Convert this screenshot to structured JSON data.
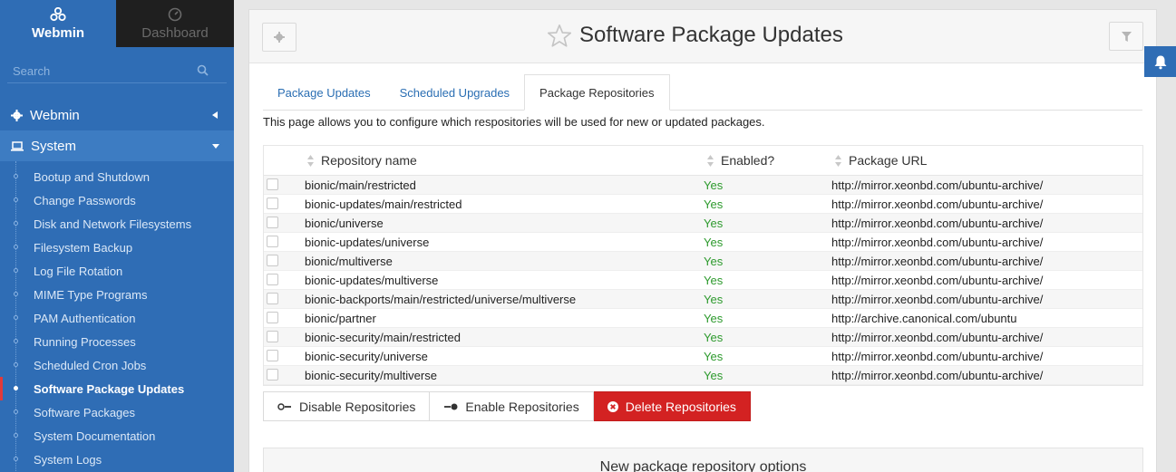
{
  "sidebar": {
    "webmin_tab": "Webmin",
    "dashboard_tab": "Dashboard",
    "search_placeholder": "Search",
    "sections": [
      {
        "label": "Webmin",
        "icon": "gear-icon"
      },
      {
        "label": "System",
        "icon": "laptop-icon"
      }
    ],
    "items": [
      "Bootup and Shutdown",
      "Change Passwords",
      "Disk and Network Filesystems",
      "Filesystem Backup",
      "Log File Rotation",
      "MIME Type Programs",
      "PAM Authentication",
      "Running Processes",
      "Scheduled Cron Jobs",
      "Software Package Updates",
      "Software Packages",
      "System Documentation",
      "System Logs"
    ],
    "active_item": "Software Package Updates"
  },
  "header": {
    "title": "Software Package Updates",
    "left_icon": "gear-icon",
    "right_icon": "filter-icon",
    "star_icon": "star-outline-icon"
  },
  "tabs": [
    {
      "label": "Package Updates",
      "active": false
    },
    {
      "label": "Scheduled Upgrades",
      "active": false
    },
    {
      "label": "Package Repositories",
      "active": true
    }
  ],
  "description": "This page allows you to configure which respositories will be used for new or updated packages.",
  "table": {
    "columns": [
      "Repository name",
      "Enabled?",
      "Package URL"
    ],
    "rows": [
      {
        "name": "bionic/main/restricted",
        "enabled": "Yes",
        "url": "http://mirror.xeonbd.com/ubuntu-archive/"
      },
      {
        "name": "bionic-updates/main/restricted",
        "enabled": "Yes",
        "url": "http://mirror.xeonbd.com/ubuntu-archive/"
      },
      {
        "name": "bionic/universe",
        "enabled": "Yes",
        "url": "http://mirror.xeonbd.com/ubuntu-archive/"
      },
      {
        "name": "bionic-updates/universe",
        "enabled": "Yes",
        "url": "http://mirror.xeonbd.com/ubuntu-archive/"
      },
      {
        "name": "bionic/multiverse",
        "enabled": "Yes",
        "url": "http://mirror.xeonbd.com/ubuntu-archive/"
      },
      {
        "name": "bionic-updates/multiverse",
        "enabled": "Yes",
        "url": "http://mirror.xeonbd.com/ubuntu-archive/"
      },
      {
        "name": "bionic-backports/main/restricted/universe/multiverse",
        "enabled": "Yes",
        "url": "http://mirror.xeonbd.com/ubuntu-archive/"
      },
      {
        "name": "bionic/partner",
        "enabled": "Yes",
        "url": "http://archive.canonical.com/ubuntu"
      },
      {
        "name": "bionic-security/main/restricted",
        "enabled": "Yes",
        "url": "http://mirror.xeonbd.com/ubuntu-archive/"
      },
      {
        "name": "bionic-security/universe",
        "enabled": "Yes",
        "url": "http://mirror.xeonbd.com/ubuntu-archive/"
      },
      {
        "name": "bionic-security/multiverse",
        "enabled": "Yes",
        "url": "http://mirror.xeonbd.com/ubuntu-archive/"
      }
    ]
  },
  "actions": {
    "disable": "Disable Repositories",
    "enable": "Enable Repositories",
    "delete": "Delete Repositories"
  },
  "new_options_title": "New package repository options",
  "colors": {
    "sidebar_bg": "#2f6db5",
    "link": "#2a6eb3",
    "enabled_yes": "#2d9a2d",
    "danger": "#d32222"
  }
}
